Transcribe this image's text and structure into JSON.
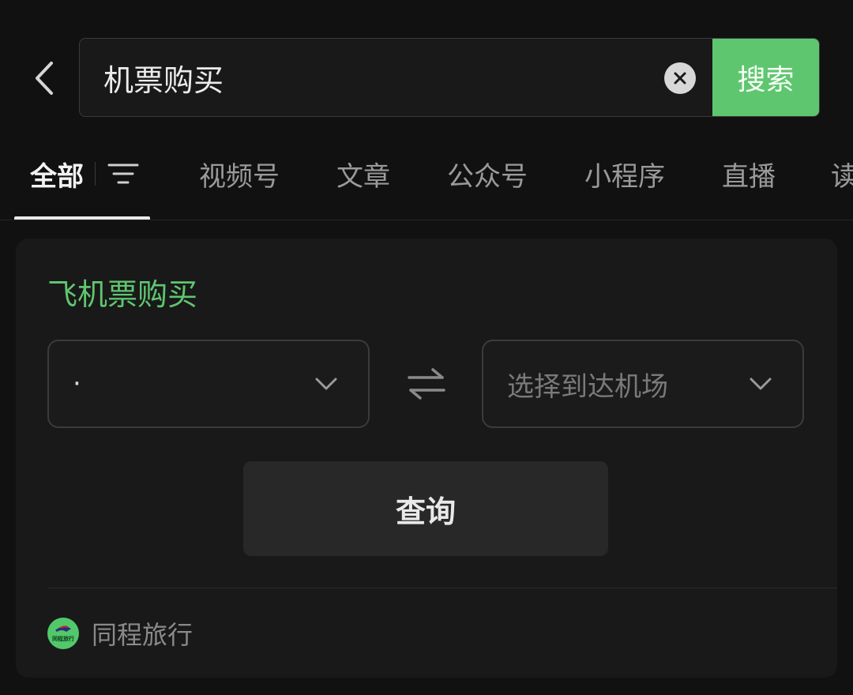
{
  "search": {
    "query": "机票购买",
    "button_label": "搜索"
  },
  "tabs": [
    {
      "label": "全部",
      "active": true
    },
    {
      "label": "视频号",
      "active": false
    },
    {
      "label": "文章",
      "active": false
    },
    {
      "label": "公众号",
      "active": false
    },
    {
      "label": "小程序",
      "active": false
    },
    {
      "label": "直播",
      "active": false
    },
    {
      "label": "读",
      "active": false
    }
  ],
  "card": {
    "title": "飞机票购买",
    "departure_value": "·",
    "arrival_placeholder": "选择到达机场",
    "query_label": "查询",
    "provider": {
      "name": "同程旅行",
      "logo_text": "同程旅行"
    }
  },
  "colors": {
    "accent": "#5fc670",
    "background": "#111111",
    "card": "#191919"
  },
  "icons": {
    "back": "chevron-left-icon",
    "clear": "clear-icon",
    "filter": "filter-icon",
    "swap": "swap-icon",
    "dropdown": "chevron-down-icon"
  }
}
